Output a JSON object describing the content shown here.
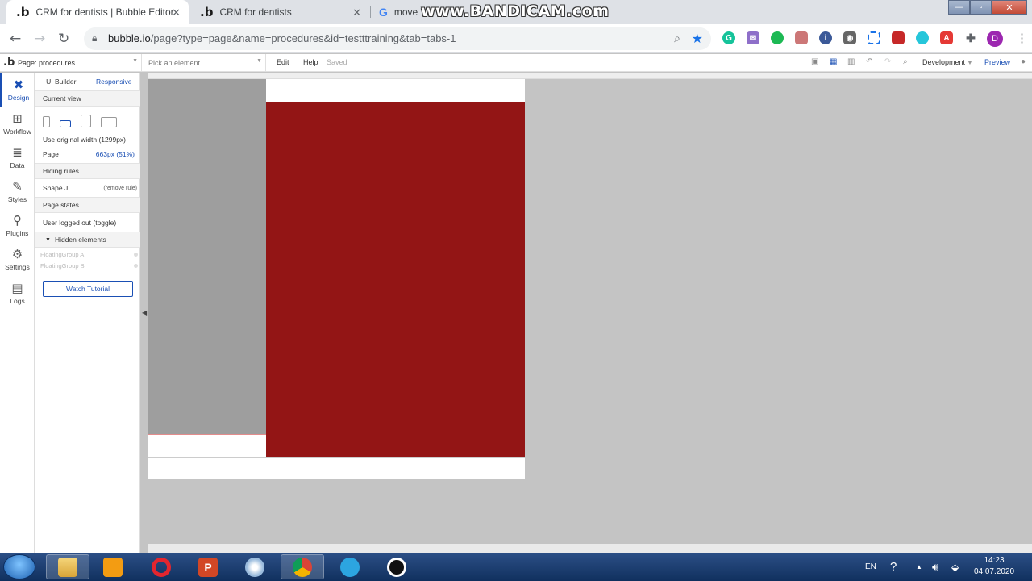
{
  "browser": {
    "tabs": [
      {
        "favicon": ".b",
        "title": "CRM for dentists | Bubble Editor",
        "active": true
      },
      {
        "favicon": ".b",
        "title": "CRM for dentists",
        "active": false
      },
      {
        "favicon": "G",
        "title": "move",
        "active": false
      }
    ],
    "overlay_watermark": "www.BANDICAM.com",
    "url_domain": "bubble.io",
    "url_path": "/page?type=page&name=procedures&id=testttraining&tab=tabs-1",
    "profile_initial": "D",
    "window_controls": {
      "minimize": "—",
      "maximize": "▫",
      "close": "✕"
    }
  },
  "editor": {
    "logo": ".b",
    "page_selector": "Page: procedures",
    "element_picker": "Pick an element...",
    "menu": {
      "edit": "Edit",
      "help": "Help",
      "status": "Saved"
    },
    "environment": "Development",
    "preview": "Preview"
  },
  "rail": [
    {
      "label": "Design",
      "icon": "design-icon",
      "active": true
    },
    {
      "label": "Workflow",
      "icon": "workflow-icon",
      "active": false
    },
    {
      "label": "Data",
      "icon": "data-icon",
      "active": false
    },
    {
      "label": "Styles",
      "icon": "styles-icon",
      "active": false
    },
    {
      "label": "Plugins",
      "icon": "plugins-icon",
      "active": false
    },
    {
      "label": "Settings",
      "icon": "settings-icon",
      "active": false
    },
    {
      "label": "Logs",
      "icon": "logs-icon",
      "active": false
    }
  ],
  "panel": {
    "tabs": {
      "ui_builder": "UI Builder",
      "responsive": "Responsive"
    },
    "current_view": "Current view",
    "use_original_width": "Use original width (1299px)",
    "page_label": "Page",
    "page_value": "663px (51%)",
    "hiding_rules": "Hiding rules",
    "shape_label": "Shape J",
    "remove_rule": "(remove rule)",
    "page_states": "Page states",
    "user_state": "User logged out (toggle)",
    "hidden_elements": "Hidden elements",
    "hidden_items": [
      "FloatingGroup A",
      "FloatingGroup B"
    ],
    "tutorial_button": "Watch Tutorial"
  },
  "canvas": {
    "shape_red_color": "#931515",
    "shape_gray_color": "#9e9e9e",
    "background_color": "#c4c4c4"
  },
  "taskbar": {
    "language": "EN",
    "time": "14:23",
    "date": "04.07.2020"
  }
}
